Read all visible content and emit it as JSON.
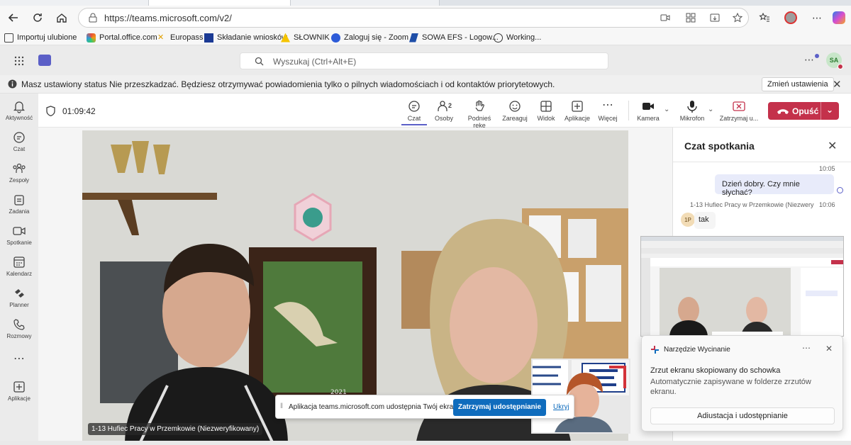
{
  "browser": {
    "url": "https://teams.microsoft.com/v2/",
    "favorites": [
      {
        "label": "Importuj ulubione",
        "icon": "folder-icon"
      },
      {
        "label": "Portal.office.com",
        "icon": "office-icon"
      },
      {
        "label": "Europass",
        "icon": "europass-icon"
      },
      {
        "label": "Składanie wniosków",
        "icon": "eu-flag-icon"
      },
      {
        "label": "SŁOWNIK",
        "icon": "warning-icon"
      },
      {
        "label": "Zaloguj się - Zoom",
        "icon": "zoom-icon"
      },
      {
        "label": "SOWA EFS - Logow...",
        "icon": "sowa-icon"
      },
      {
        "label": "Working...",
        "icon": "globe-icon"
      }
    ]
  },
  "teams": {
    "search_placeholder": "Wyszukaj (Ctrl+Alt+E)",
    "user_initials": "SA",
    "notice": {
      "text": "Masz ustawiony status Nie przeszkadzać. Będziesz otrzymywać powiadomienia tylko o pilnych wiadomościach i od kontaktów priorytetowych.",
      "button": "Zmień ustawienia"
    },
    "rail": [
      {
        "label": "Aktywność",
        "icon": "bell-icon"
      },
      {
        "label": "Czat",
        "icon": "chat-icon"
      },
      {
        "label": "Zespoły",
        "icon": "teams-icon"
      },
      {
        "label": "Zadania",
        "icon": "tasks-icon"
      },
      {
        "label": "Spotkanie",
        "icon": "video-icon"
      },
      {
        "label": "Kalendarz",
        "icon": "calendar-icon"
      },
      {
        "label": "Planner",
        "icon": "planner-icon"
      },
      {
        "label": "Rozmowy",
        "icon": "phone-icon"
      },
      {
        "label": "Aplikacje",
        "icon": "plus-square-icon"
      }
    ]
  },
  "meeting": {
    "timer": "01:09:42",
    "participants_count": "2",
    "tools": [
      {
        "label": "Czat",
        "icon": "chat-icon"
      },
      {
        "label": "Osoby",
        "icon": "people-icon"
      },
      {
        "label": "Podnieś rękę",
        "icon": "hand-icon"
      },
      {
        "label": "Zareaguj",
        "icon": "smile-icon"
      },
      {
        "label": "Widok",
        "icon": "grid-icon"
      },
      {
        "label": "Aplikacje",
        "icon": "plus-square-icon"
      },
      {
        "label": "Więcej",
        "icon": "more-icon"
      },
      {
        "label": "Kamera",
        "icon": "camera-icon"
      },
      {
        "label": "Mikrofon",
        "icon": "mic-icon"
      },
      {
        "label": "Zatrzymaj u...",
        "icon": "stop-share-icon"
      }
    ],
    "leave_label": "Opuść",
    "participant_name": "1-13 Hufiec Pracy w Przemkowie (Niezweryfikowany)",
    "video_year": "2021",
    "share_bar": {
      "text": "Aplikacja teams.microsoft.com udostępnia Twój ekran.",
      "stop": "Zatrzymaj udostępnianie",
      "hide": "Ukryj"
    }
  },
  "chat": {
    "title": "Czat spotkania",
    "messages": [
      {
        "time": "10:05",
        "text": "Dzień dobry. Czy mnie słychać?"
      },
      {
        "sender": "1-13 Hufiec Pracy w Przemkowie (Niezwery",
        "time": "10:06",
        "initials": "1P",
        "text": "tak"
      }
    ]
  },
  "toast": {
    "app": "Narzędzie Wycinanie",
    "heading": "Zrzut ekranu skopiowany do schowka",
    "body": "Automatycznie zapisywane w folderze zrzutów ekranu.",
    "action": "Adiustacja i udostępnianie"
  }
}
